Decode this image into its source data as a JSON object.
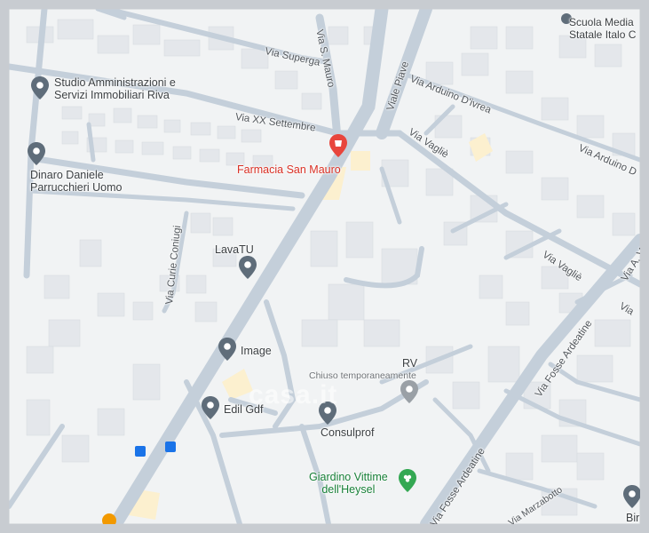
{
  "map": {
    "pois": [
      {
        "label": "Studio Amministrazioni e",
        "label2": "Servizi Immobiliari Riva",
        "icon": "pin-icon"
      },
      {
        "label": "Dinaro Daniele",
        "label2": "Parrucchieri Uomo",
        "icon": "pin-icon"
      },
      {
        "label": "Farmacia San Mauro",
        "icon": "pharmacy-icon"
      },
      {
        "label": "LavaTU",
        "icon": "pin-icon"
      },
      {
        "label": "Image",
        "icon": "pin-icon"
      },
      {
        "label": "Edil Gdf",
        "icon": "pin-icon"
      },
      {
        "label": "Consulprof",
        "icon": "pin-icon"
      },
      {
        "label": "RV",
        "sublabel": "Chiuso temporaneamente",
        "icon": "pin-icon"
      },
      {
        "label": "Giardino Vittime",
        "label2": "dell'Heysel",
        "icon": "park-icon"
      },
      {
        "label": "Scuola Media",
        "label2": "Statale Italo C",
        "icon": "school-icon"
      },
      {
        "label": "Bir",
        "icon": "pin-icon"
      }
    ],
    "streets": [
      {
        "name": "Via Superga"
      },
      {
        "name": "Via S. Mauro"
      },
      {
        "name": "Viale Piave"
      },
      {
        "name": "Via XX Settembre"
      },
      {
        "name": "Via Arduino D'ivrea"
      },
      {
        "name": "Via Arduino D"
      },
      {
        "name": "Via Vagliè"
      },
      {
        "name": "Via Vagliè"
      },
      {
        "name": "Via Curie Coniugi"
      },
      {
        "name": "Via Fosse Ardeatine"
      },
      {
        "name": "Via Fosse Ardeatine"
      },
      {
        "name": "Via A. V"
      },
      {
        "name": "Via"
      },
      {
        "name": "Via Marzabotto"
      }
    ],
    "watermark": "casa.it",
    "colors": {
      "land": "#f1f3f4",
      "road": "#c3ced9",
      "building": "#e3e6ea",
      "pin": "#5f6d7a",
      "pharmacy": "#e8453c",
      "park": "#34a853",
      "highlight": "#fdf2d0"
    }
  }
}
